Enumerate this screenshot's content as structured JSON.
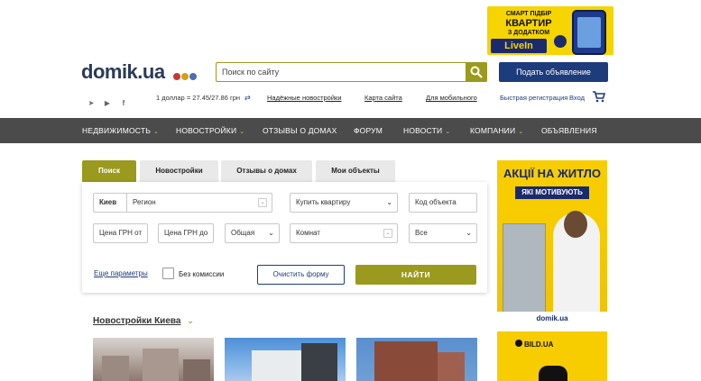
{
  "top_banner": {
    "line1": "СМАРТ ПІДБІР",
    "line2": "КВАРТИР",
    "line3": "З ДОДАТКОМ",
    "brand": "LiveIn"
  },
  "header": {
    "logo_text": "domik.ua",
    "logo_dot_colors": [
      "#c83737",
      "#d4a017",
      "#4a6fb5"
    ],
    "search_placeholder": "Поиск по сайту",
    "post_ad_label": "Подать объявление"
  },
  "subheader": {
    "social_icons": [
      "telegram-icon",
      "youtube-icon",
      "facebook-icon"
    ],
    "rate_text": "1 доллар = 27.45/27.86 грн",
    "links": [
      "Надёжные новостройки",
      "Карта сайта",
      "Для мобильного"
    ],
    "register_label": "Быстрая регистрация",
    "login_label": "Вход"
  },
  "nav": {
    "items": [
      {
        "label": "НЕДВИЖИМОСТЬ",
        "has_dropdown": true
      },
      {
        "label": "НОВОСТРОЙКИ",
        "has_dropdown": true
      },
      {
        "label": "ОТЗЫВЫ О ДОМАХ",
        "has_dropdown": false
      },
      {
        "label": "ФОРУМ",
        "has_dropdown": false
      },
      {
        "label": "НОВОСТИ",
        "has_dropdown": true
      },
      {
        "label": "КОМПАНИИ",
        "has_dropdown": true
      },
      {
        "label": "ОБЪЯВЛЕНИЯ",
        "has_dropdown": false
      }
    ]
  },
  "search_panel": {
    "tabs": [
      "Поиск",
      "Новостройки",
      "Отзывы о домах",
      "Мои объекты"
    ],
    "active_tab": "Поиск",
    "city": "Киев",
    "region_placeholder": "Регион",
    "deal_type": "Купить квартиру",
    "object_code_placeholder": "Код объекта",
    "price_from_placeholder": "Цена ГРН от",
    "price_to_placeholder": "Цена ГРН до",
    "area_type": "Общая",
    "rooms_placeholder": "Комнат",
    "all_option": "Все",
    "more_params_label": "Еще параметры",
    "no_commission_label": "Без комиссии",
    "clear_label": "Очистить форму",
    "find_label": "НАЙТИ"
  },
  "new_buildings": {
    "title": "Новостройки Киева"
  },
  "side_ads": {
    "ad1_title_line1": "АКЦІЇ НА ЖИТЛО",
    "ad1_title_line2": "ЯКІ МОТИВУЮТЬ",
    "ad1_footer": "domik.ua",
    "ad2_brand": "BILD.UA"
  },
  "colors": {
    "accent": "#9a9a1e",
    "brand_blue": "#1d3c7c",
    "nav_bg": "#4b4b4b"
  }
}
